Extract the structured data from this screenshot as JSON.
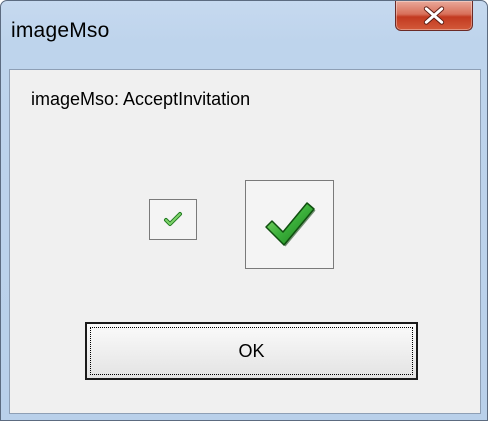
{
  "window": {
    "title": "imageMso"
  },
  "dialog": {
    "caption": "imageMso: AcceptInvitation",
    "ok_label": "OK",
    "icon_name": "accept-invitation-checkmark-icon"
  },
  "colors": {
    "titlebar": "#b9d0ea",
    "close_button": "#c23a20",
    "client_background": "#f0f0f0",
    "checkmark_green": "#2fa52f"
  }
}
